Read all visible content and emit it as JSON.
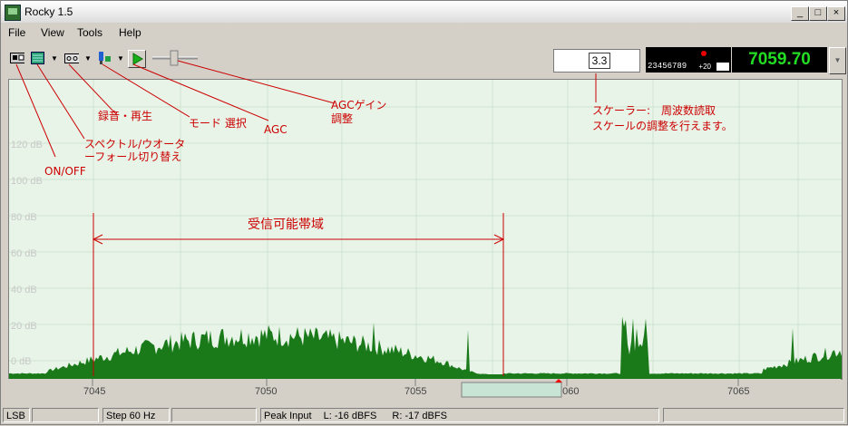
{
  "window": {
    "title": "Rocky 1.5"
  },
  "title_buttons": {
    "minimize": "_",
    "maximize": "□",
    "close": "×"
  },
  "menu": {
    "items": [
      "File",
      "View",
      "Tools",
      "Help"
    ]
  },
  "toolbar": {
    "scale_value": "3.3"
  },
  "display": {
    "digits": "23456789",
    "plus20": "+20",
    "frequency": "7059.70"
  },
  "spectrum": {
    "db_labels": [
      "120 dB",
      "100 dB",
      "80 dB",
      "60 dB",
      "40 dB",
      "20 dB",
      "0 dB"
    ],
    "freq_labels": [
      "7045",
      "7050",
      "7055",
      "7060",
      "7065"
    ]
  },
  "annotations": {
    "onoff": "ON/OFF",
    "spectrum_waterfall_1": "スペクトル/ウオータ",
    "spectrum_waterfall_2": "ーフォール切り替え",
    "record": "録音・再生",
    "mode": "モード 選択",
    "agc": "AGC",
    "agc_gain_1": "AGCゲイン",
    "agc_gain_2": "調整",
    "scaler_1": "スケーラー:　周波数読取",
    "scaler_2": "スケールの調整を行えます。",
    "passband": "受信可能帯域"
  },
  "status": {
    "mode": "LSB",
    "step": "Step 60 Hz",
    "peak": "Peak Input",
    "left": "L: -16 dBFS",
    "right": "R: -17 dBFS"
  },
  "colors": {
    "signal": "#1a7a1a",
    "annotation": "#cc0000",
    "freq_display": "#22dd22",
    "grid_bg": "#e8f4e8"
  }
}
